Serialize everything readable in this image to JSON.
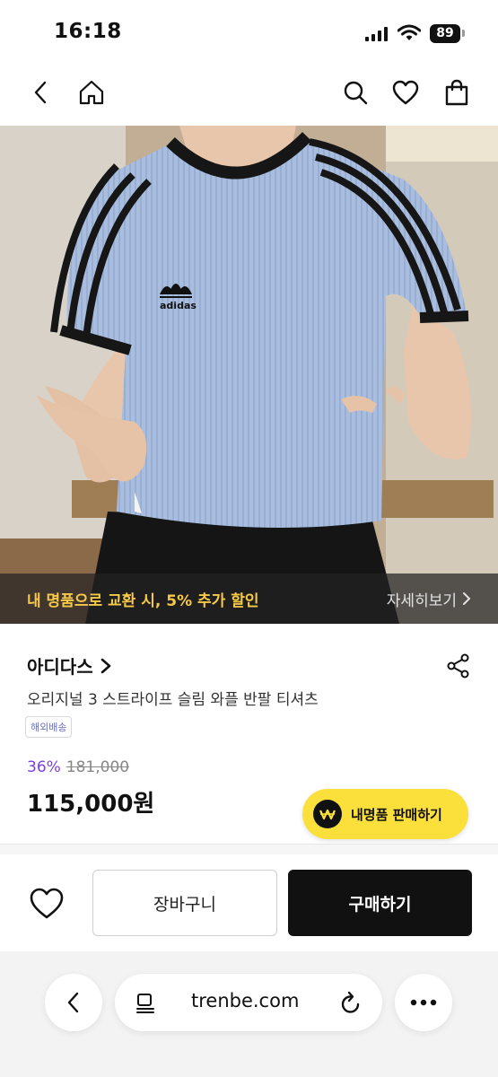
{
  "status": {
    "time": "16:18",
    "battery": "89"
  },
  "promo": {
    "text": "내 명품으로 교환 시, 5% 추가 할인",
    "link": "자세히보기"
  },
  "product": {
    "brand": "아디다스",
    "name": "오리지널 3 스트라이프 슬림 와플 반팔 티셔츠",
    "badge": "해외배송",
    "discount": "36%",
    "original_price": "181,000",
    "price": "115,000원",
    "image_logo_text": "adidas"
  },
  "sell_button": {
    "label": "내명품 판매하기"
  },
  "actions": {
    "cart": "장바구니",
    "buy": "구매하기"
  },
  "browser": {
    "url": "trenbe.com"
  },
  "colors": {
    "promo": "#f7c948",
    "discount": "#7b3fe4",
    "sell_bg": "#fbe03b",
    "buy_bg": "#111111",
    "badge": "#6a6fb8"
  },
  "icons": [
    "back-icon",
    "home-icon",
    "search-icon",
    "heart-icon",
    "bag-icon",
    "share-icon",
    "chevron-right-icon",
    "won-icon",
    "reader-icon",
    "reload-icon",
    "more-icon"
  ]
}
